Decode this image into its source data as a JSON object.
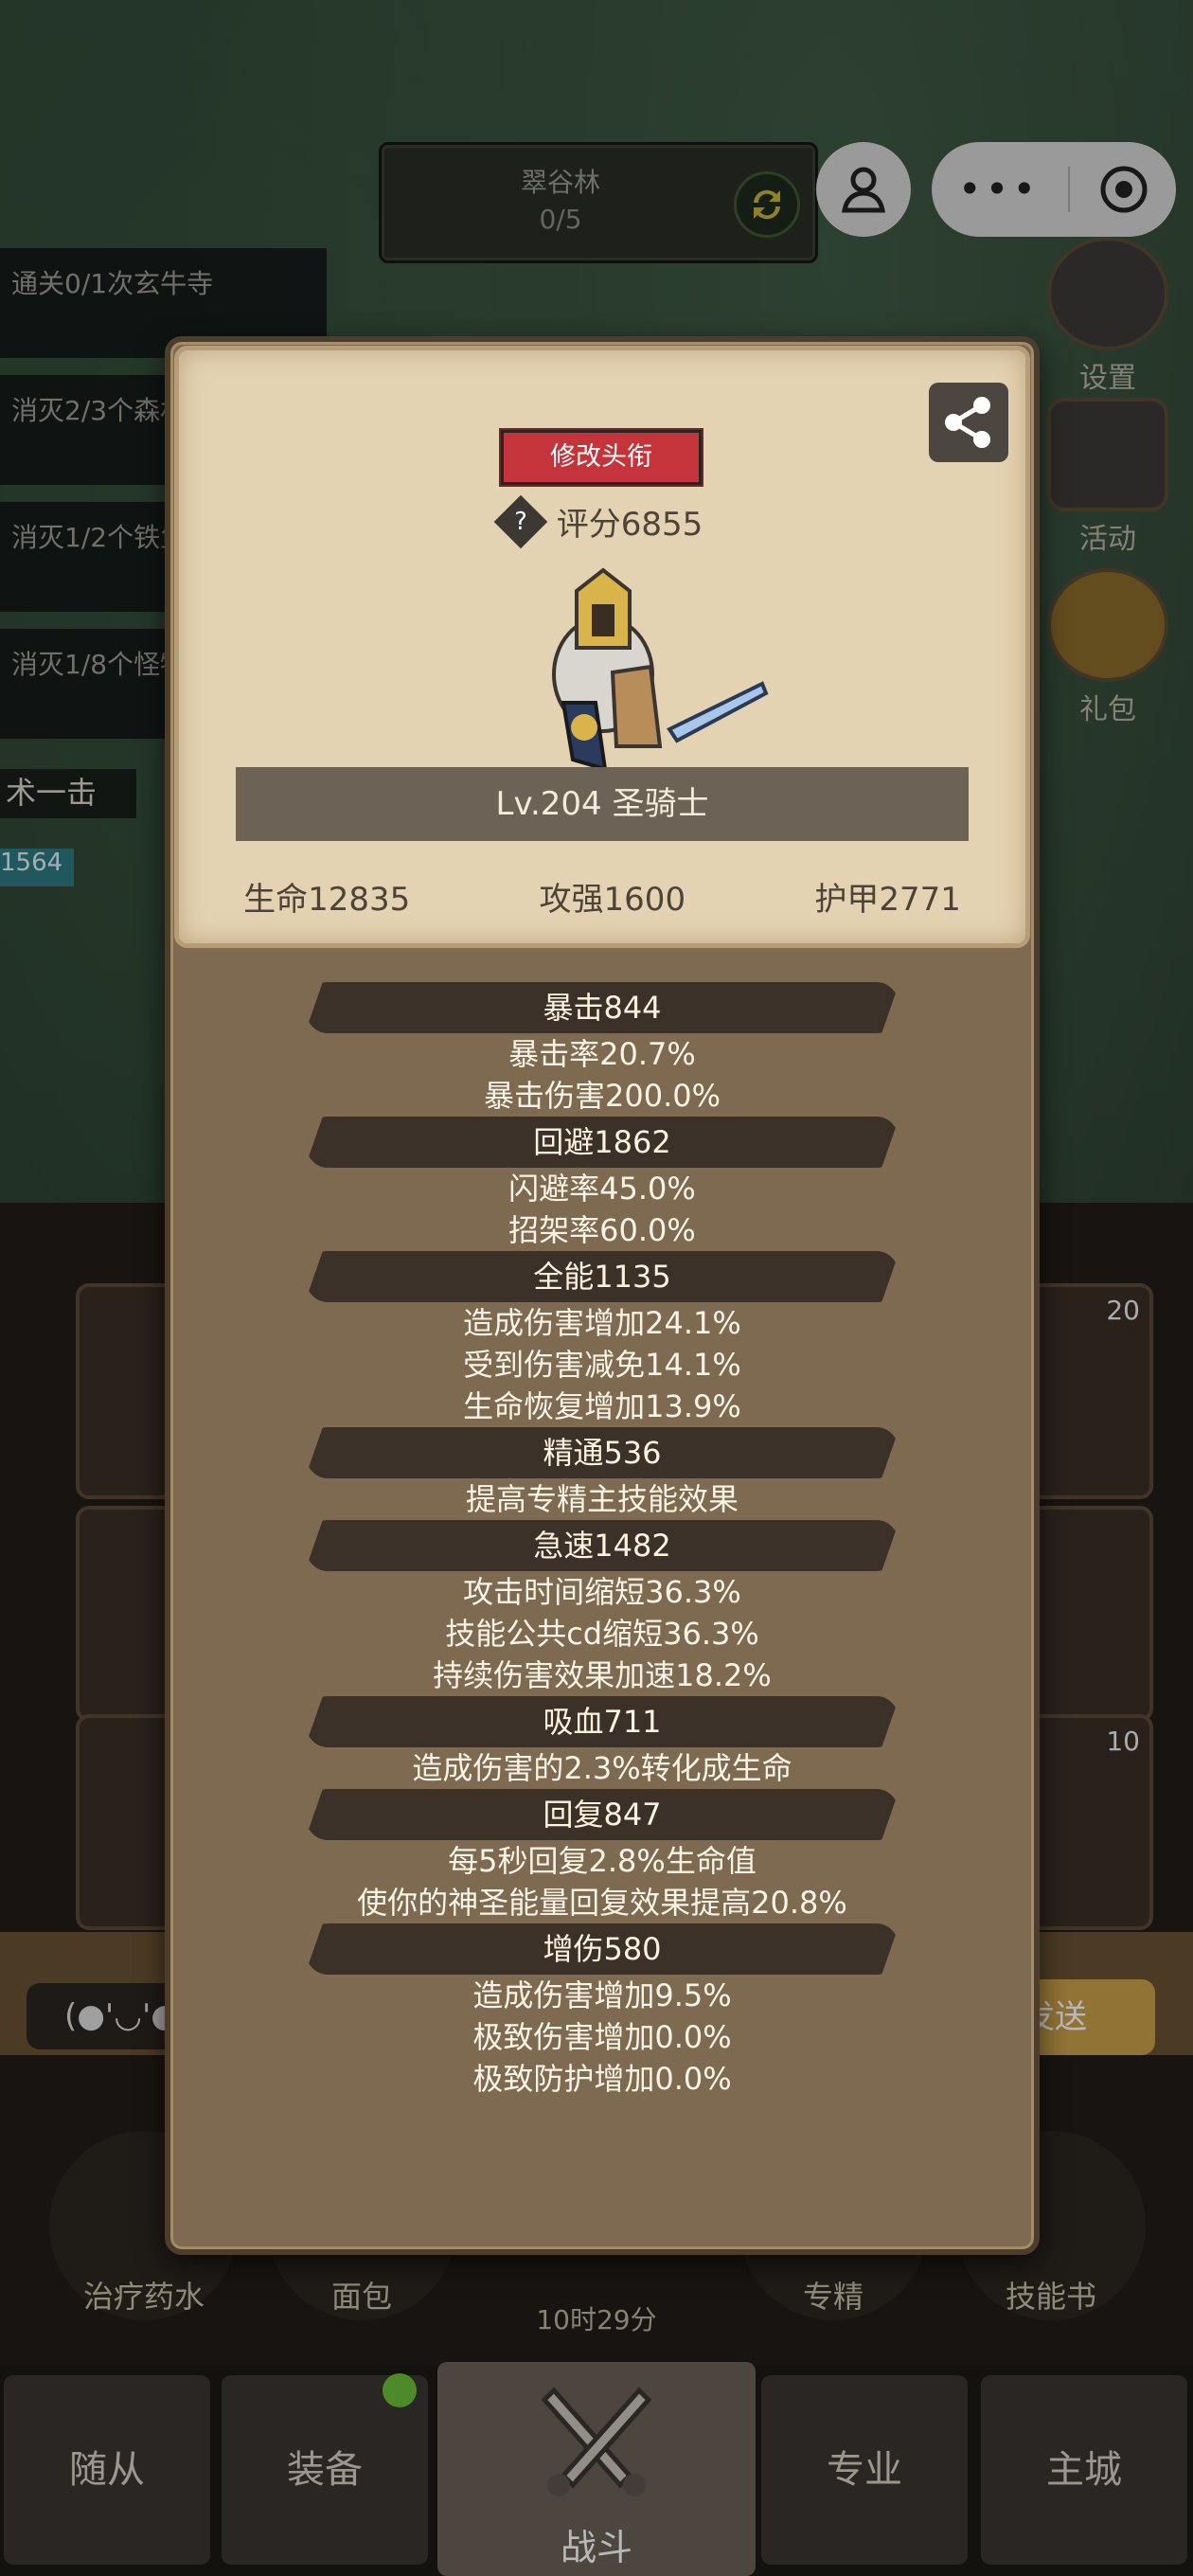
{
  "map": {
    "name": "翠谷林",
    "progress": "0/5"
  },
  "top_right": {
    "settings": "设置",
    "activity": "活动",
    "gift": "礼包"
  },
  "quests": [
    "通关0/1次玄牛寺",
    "消灭2/3个森林徘徊者",
    "消灭1/2个铁鱼人",
    "消灭1/8个怪物"
  ],
  "skill_tag": "术一击",
  "hp_tag": "1564",
  "slots": {
    "count_a": "20",
    "count_b": "10"
  },
  "chat": {
    "input_text": "(●'◡'●",
    "send_label": "发送"
  },
  "consumables": [
    "治疗药水",
    "面包",
    "专精",
    "技能书"
  ],
  "timer": "10时29分",
  "nav": {
    "tabs": [
      "随从",
      "装备",
      "战斗",
      "专业",
      "主城"
    ]
  },
  "hero": {
    "title_button": "修改头衔",
    "score": "评分6855",
    "name": "Lv.204 圣骑士",
    "hp": "生命12835",
    "attack": "攻强1600",
    "armor": "护甲2771"
  },
  "stats": [
    {
      "head": "暴击844",
      "lines": [
        "暴击率20.7%",
        "暴击伤害200.0%"
      ]
    },
    {
      "head": "回避1862",
      "lines": [
        "闪避率45.0%",
        "招架率60.0%"
      ]
    },
    {
      "head": "全能1135",
      "lines": [
        "造成伤害增加24.1%",
        "受到伤害减免14.1%",
        "生命恢复增加13.9%"
      ]
    },
    {
      "head": "精通536",
      "lines": [
        "提高专精主技能效果"
      ]
    },
    {
      "head": "急速1482",
      "lines": [
        "攻击时间缩短36.3%",
        "技能公共cd缩短36.3%",
        "持续伤害效果加速18.2%"
      ]
    },
    {
      "head": "吸血711",
      "lines": [
        "造成伤害的2.3%转化成生命"
      ]
    },
    {
      "head": "回复847",
      "lines": [
        "每5秒回复2.8%生命值",
        "使你的神圣能量回复效果提高20.8%"
      ]
    },
    {
      "head": "增伤580",
      "lines": [
        "造成伤害增加9.5%",
        "极致伤害增加0.0%",
        "极致防护增加0.0%"
      ]
    }
  ]
}
